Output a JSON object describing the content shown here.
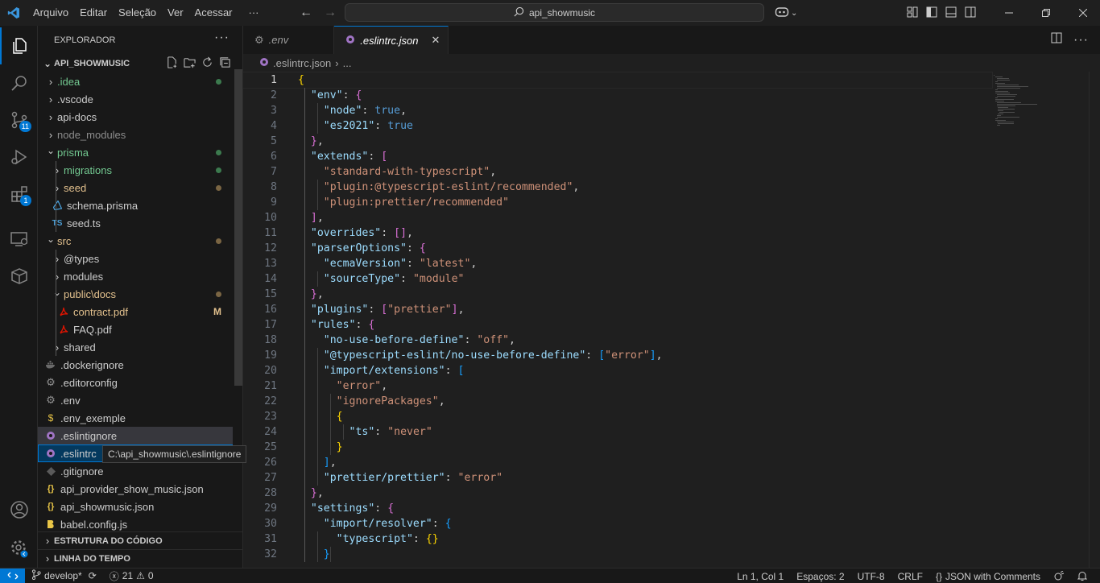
{
  "menu": [
    "Arquivo",
    "Editar",
    "Seleção",
    "Ver",
    "Acessar",
    "···"
  ],
  "command_center": "api_showmusic",
  "sidebar": {
    "title": "EXPLORADOR",
    "root": "API_SHOWMUSIC",
    "tree": [
      {
        "label": ".idea",
        "color": "#73c991",
        "deco": "dot",
        "deco_color": "#3c7a4e",
        "chevron": "›"
      },
      {
        "label": ".vscode",
        "color": "#cccccc",
        "chevron": "›"
      },
      {
        "label": "api-docs",
        "color": "#cccccc",
        "chevron": "›"
      },
      {
        "label": "node_modules",
        "color": "#8c8c8c",
        "chevron": "›"
      },
      {
        "label": "prisma",
        "color": "#73c991",
        "deco": "dot",
        "deco_color": "#3c7a4e",
        "chevron": "⌄"
      },
      {
        "label": "migrations",
        "color": "#73c991",
        "deco": "dot",
        "deco_color": "#3c7a4e",
        "chevron": "›"
      },
      {
        "label": "seed",
        "color": "#e2c08d",
        "deco": "dot",
        "deco_color": "#7a6543",
        "chevron": "›"
      },
      {
        "label": "schema.prisma",
        "color": "#cccccc",
        "icon": "prisma-icon"
      },
      {
        "label": "seed.ts",
        "color": "#cccccc",
        "icon": "typescript-icon",
        "icon_text": "TS"
      },
      {
        "label": "src",
        "color": "#e2c08d",
        "deco": "dot",
        "deco_color": "#7a6543",
        "chevron": "⌄"
      },
      {
        "label": "@types",
        "color": "#cccccc",
        "chevron": "›"
      },
      {
        "label": "modules",
        "color": "#cccccc",
        "chevron": "›"
      },
      {
        "label": "public\\docs",
        "color": "#e2c08d",
        "deco": "dot",
        "deco_color": "#7a6543",
        "chevron": "⌄"
      },
      {
        "label": "contract.pdf",
        "color": "#e2c08d",
        "deco": "M",
        "deco_color": "#e2c08d",
        "icon": "pdf-icon"
      },
      {
        "label": "FAQ.pdf",
        "color": "#cccccc",
        "icon": "pdf-icon"
      },
      {
        "label": "shared",
        "color": "#cccccc",
        "chevron": "›"
      },
      {
        "label": ".dockerignore",
        "color": "#cccccc",
        "icon": "docker-icon"
      },
      {
        "label": ".editorconfig",
        "color": "#cccccc",
        "icon": "gear-icon"
      },
      {
        "label": ".env",
        "color": "#cccccc",
        "icon": "gear-icon"
      },
      {
        "label": ".env_exemple",
        "color": "#cccccc",
        "icon": "dollar-icon",
        "icon_text": "$"
      },
      {
        "label": ".eslintignore",
        "color": "#cccccc",
        "icon": "eslint-icon"
      },
      {
        "label": ".eslintrc",
        "color": "#cccccc",
        "icon": "eslint-icon"
      },
      {
        "label": ".gitignore",
        "color": "#cccccc",
        "icon": "git-icon"
      },
      {
        "label": "api_provider_show_music.json",
        "color": "#cccccc",
        "icon": "json-icon",
        "icon_text": "{}"
      },
      {
        "label": "api_showmusic.json",
        "color": "#cccccc",
        "icon": "json-icon",
        "icon_text": "{}"
      },
      {
        "label": "babel.config.js",
        "color": "#cccccc",
        "icon": "babel-icon"
      }
    ],
    "tooltip": "C:\\api_showmusic\\.eslintignore",
    "sections": [
      "ESTRUTURA DO CÓDIGO",
      "LINHA DO TEMPO"
    ]
  },
  "activity_badges": {
    "source_control": "11",
    "extensions": "1"
  },
  "tabs": [
    {
      "label": ".env",
      "icon": "gear-icon"
    },
    {
      "label": ".eslintrc.json",
      "icon": "eslint-icon"
    }
  ],
  "breadcrumb": {
    "file": ".eslintrc.json",
    "more": "..."
  },
  "code_lines": [
    {
      "n": "1",
      "tokens": [
        [
          "b1",
          "{"
        ]
      ]
    },
    {
      "n": "2",
      "tokens": [
        [
          "pun",
          "  "
        ],
        [
          "key",
          "\"env\""
        ],
        [
          "pun",
          ": "
        ],
        [
          "b2",
          "{"
        ]
      ]
    },
    {
      "n": "3",
      "tokens": [
        [
          "pun",
          "    "
        ],
        [
          "key",
          "\"node\""
        ],
        [
          "pun",
          ": "
        ],
        [
          "bool",
          "true"
        ],
        [
          "pun",
          ","
        ]
      ]
    },
    {
      "n": "4",
      "tokens": [
        [
          "pun",
          "    "
        ],
        [
          "key",
          "\"es2021\""
        ],
        [
          "pun",
          ": "
        ],
        [
          "bool",
          "true"
        ]
      ]
    },
    {
      "n": "5",
      "tokens": [
        [
          "pun",
          "  "
        ],
        [
          "b2",
          "}"
        ],
        [
          "pun",
          ","
        ]
      ]
    },
    {
      "n": "6",
      "tokens": [
        [
          "pun",
          "  "
        ],
        [
          "key",
          "\"extends\""
        ],
        [
          "pun",
          ": "
        ],
        [
          "b2",
          "["
        ]
      ]
    },
    {
      "n": "7",
      "tokens": [
        [
          "pun",
          "    "
        ],
        [
          "str",
          "\"standard-with-typescript\""
        ],
        [
          "pun",
          ","
        ]
      ]
    },
    {
      "n": "8",
      "tokens": [
        [
          "pun",
          "    "
        ],
        [
          "str",
          "\"plugin:@typescript-eslint/recommended\""
        ],
        [
          "pun",
          ","
        ]
      ]
    },
    {
      "n": "9",
      "tokens": [
        [
          "pun",
          "    "
        ],
        [
          "str",
          "\"plugin:prettier/recommended\""
        ]
      ]
    },
    {
      "n": "10",
      "tokens": [
        [
          "pun",
          "  "
        ],
        [
          "b2",
          "]"
        ],
        [
          "pun",
          ","
        ]
      ]
    },
    {
      "n": "11",
      "tokens": [
        [
          "pun",
          "  "
        ],
        [
          "key",
          "\"overrides\""
        ],
        [
          "pun",
          ": "
        ],
        [
          "b2",
          "[]"
        ],
        [
          "pun",
          ","
        ]
      ]
    },
    {
      "n": "12",
      "tokens": [
        [
          "pun",
          "  "
        ],
        [
          "key",
          "\"parserOptions\""
        ],
        [
          "pun",
          ": "
        ],
        [
          "b2",
          "{"
        ]
      ]
    },
    {
      "n": "13",
      "tokens": [
        [
          "pun",
          "    "
        ],
        [
          "key",
          "\"ecmaVersion\""
        ],
        [
          "pun",
          ": "
        ],
        [
          "str",
          "\"latest\""
        ],
        [
          "pun",
          ","
        ]
      ]
    },
    {
      "n": "14",
      "tokens": [
        [
          "pun",
          "    "
        ],
        [
          "key",
          "\"sourceType\""
        ],
        [
          "pun",
          ": "
        ],
        [
          "str",
          "\"module\""
        ]
      ]
    },
    {
      "n": "15",
      "tokens": [
        [
          "pun",
          "  "
        ],
        [
          "b2",
          "}"
        ],
        [
          "pun",
          ","
        ]
      ]
    },
    {
      "n": "16",
      "tokens": [
        [
          "pun",
          "  "
        ],
        [
          "key",
          "\"plugins\""
        ],
        [
          "pun",
          ": "
        ],
        [
          "b2",
          "["
        ],
        [
          "str",
          "\"prettier\""
        ],
        [
          "b2",
          "]"
        ],
        [
          "pun",
          ","
        ]
      ]
    },
    {
      "n": "17",
      "tokens": [
        [
          "pun",
          "  "
        ],
        [
          "key",
          "\"rules\""
        ],
        [
          "pun",
          ": "
        ],
        [
          "b2",
          "{"
        ]
      ]
    },
    {
      "n": "18",
      "tokens": [
        [
          "pun",
          "    "
        ],
        [
          "key",
          "\"no-use-before-define\""
        ],
        [
          "pun",
          ": "
        ],
        [
          "str",
          "\"off\""
        ],
        [
          "pun",
          ","
        ]
      ]
    },
    {
      "n": "19",
      "tokens": [
        [
          "pun",
          "    "
        ],
        [
          "key",
          "\"@typescript-eslint/no-use-before-define\""
        ],
        [
          "pun",
          ": "
        ],
        [
          "b3",
          "["
        ],
        [
          "str",
          "\"error\""
        ],
        [
          "b3",
          "]"
        ],
        [
          "pun",
          ","
        ]
      ]
    },
    {
      "n": "20",
      "tokens": [
        [
          "pun",
          "    "
        ],
        [
          "key",
          "\"import/extensions\""
        ],
        [
          "pun",
          ": "
        ],
        [
          "b3",
          "["
        ]
      ]
    },
    {
      "n": "21",
      "tokens": [
        [
          "pun",
          "      "
        ],
        [
          "str",
          "\"error\""
        ],
        [
          "pun",
          ","
        ]
      ]
    },
    {
      "n": "22",
      "tokens": [
        [
          "pun",
          "      "
        ],
        [
          "str",
          "\"ignorePackages\""
        ],
        [
          "pun",
          ","
        ]
      ]
    },
    {
      "n": "23",
      "tokens": [
        [
          "pun",
          "      "
        ],
        [
          "b1",
          "{"
        ]
      ]
    },
    {
      "n": "24",
      "tokens": [
        [
          "pun",
          "        "
        ],
        [
          "key",
          "\"ts\""
        ],
        [
          "pun",
          ": "
        ],
        [
          "str",
          "\"never\""
        ]
      ]
    },
    {
      "n": "25",
      "tokens": [
        [
          "pun",
          "      "
        ],
        [
          "b1",
          "}"
        ]
      ]
    },
    {
      "n": "26",
      "tokens": [
        [
          "pun",
          "    "
        ],
        [
          "b3",
          "]"
        ],
        [
          "pun",
          ","
        ]
      ]
    },
    {
      "n": "27",
      "tokens": [
        [
          "pun",
          "    "
        ],
        [
          "key",
          "\"prettier/prettier\""
        ],
        [
          "pun",
          ": "
        ],
        [
          "str",
          "\"error\""
        ]
      ]
    },
    {
      "n": "28",
      "tokens": [
        [
          "pun",
          "  "
        ],
        [
          "b2",
          "}"
        ],
        [
          "pun",
          ","
        ]
      ]
    },
    {
      "n": "29",
      "tokens": [
        [
          "pun",
          "  "
        ],
        [
          "key",
          "\"settings\""
        ],
        [
          "pun",
          ": "
        ],
        [
          "b2",
          "{"
        ]
      ]
    },
    {
      "n": "30",
      "tokens": [
        [
          "pun",
          "    "
        ],
        [
          "key",
          "\"import/resolver\""
        ],
        [
          "pun",
          ": "
        ],
        [
          "b3",
          "{"
        ]
      ]
    },
    {
      "n": "31",
      "tokens": [
        [
          "pun",
          "      "
        ],
        [
          "key",
          "\"typescript\""
        ],
        [
          "pun",
          ": "
        ],
        [
          "b1",
          "{}"
        ]
      ]
    },
    {
      "n": "32",
      "tokens": [
        [
          "pun",
          "    "
        ],
        [
          "b3",
          "}"
        ]
      ]
    }
  ],
  "statusbar": {
    "branch": "develop*",
    "errors": "21",
    "warnings": "0",
    "position": "Ln 1, Col 1",
    "spaces": "Espaços: 2",
    "encoding": "UTF-8",
    "eol": "CRLF",
    "language": "JSON with Comments"
  },
  "colors": {
    "accent": "#0078d4",
    "background": "#1f1f1f",
    "sidebar": "#181818"
  }
}
